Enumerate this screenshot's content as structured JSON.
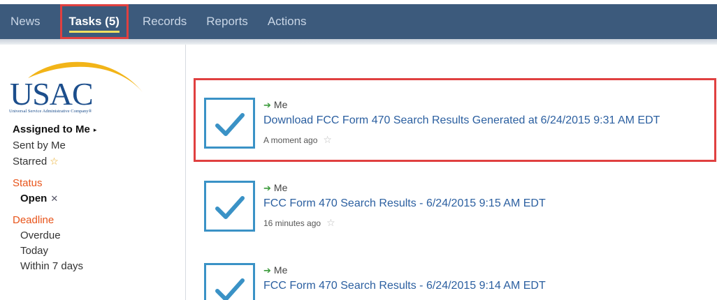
{
  "nav": {
    "tabs": [
      "News",
      "Tasks (5)",
      "Records",
      "Reports",
      "Actions"
    ]
  },
  "logo": {
    "name": "USAC",
    "tagline": "Universal Service Administrative Company®"
  },
  "sidebar": {
    "assigned": "Assigned to Me",
    "sent": "Sent by Me",
    "starred": "Starred",
    "status_heading": "Status",
    "status_open": "Open",
    "deadline_heading": "Deadline",
    "deadline_overdue": "Overdue",
    "deadline_today": "Today",
    "deadline_week": "Within 7 days"
  },
  "tasks": [
    {
      "assignee": "Me",
      "title": "Download FCC Form 470 Search Results Generated at 6/24/2015 9:31 AM EDT",
      "time": "A moment ago"
    },
    {
      "assignee": "Me",
      "title": "FCC Form 470 Search Results - 6/24/2015 9:15 AM EDT",
      "time": "16 minutes ago"
    },
    {
      "assignee": "Me",
      "title": "FCC Form 470 Search Results - 6/24/2015 9:14 AM EDT",
      "time": ""
    }
  ],
  "colors": {
    "nav_bg": "#3c5a7c",
    "link": "#2b5fa0",
    "accent_orange": "#e8541a",
    "highlight_red": "#e04040",
    "checkbox_blue": "#3a92c6"
  },
  "icons": {
    "checkbox": "checkmark-icon",
    "assignee_arrow": "arrow-right-icon",
    "star": "star-icon",
    "remove": "close-icon",
    "expand": "triangle-right-icon"
  }
}
